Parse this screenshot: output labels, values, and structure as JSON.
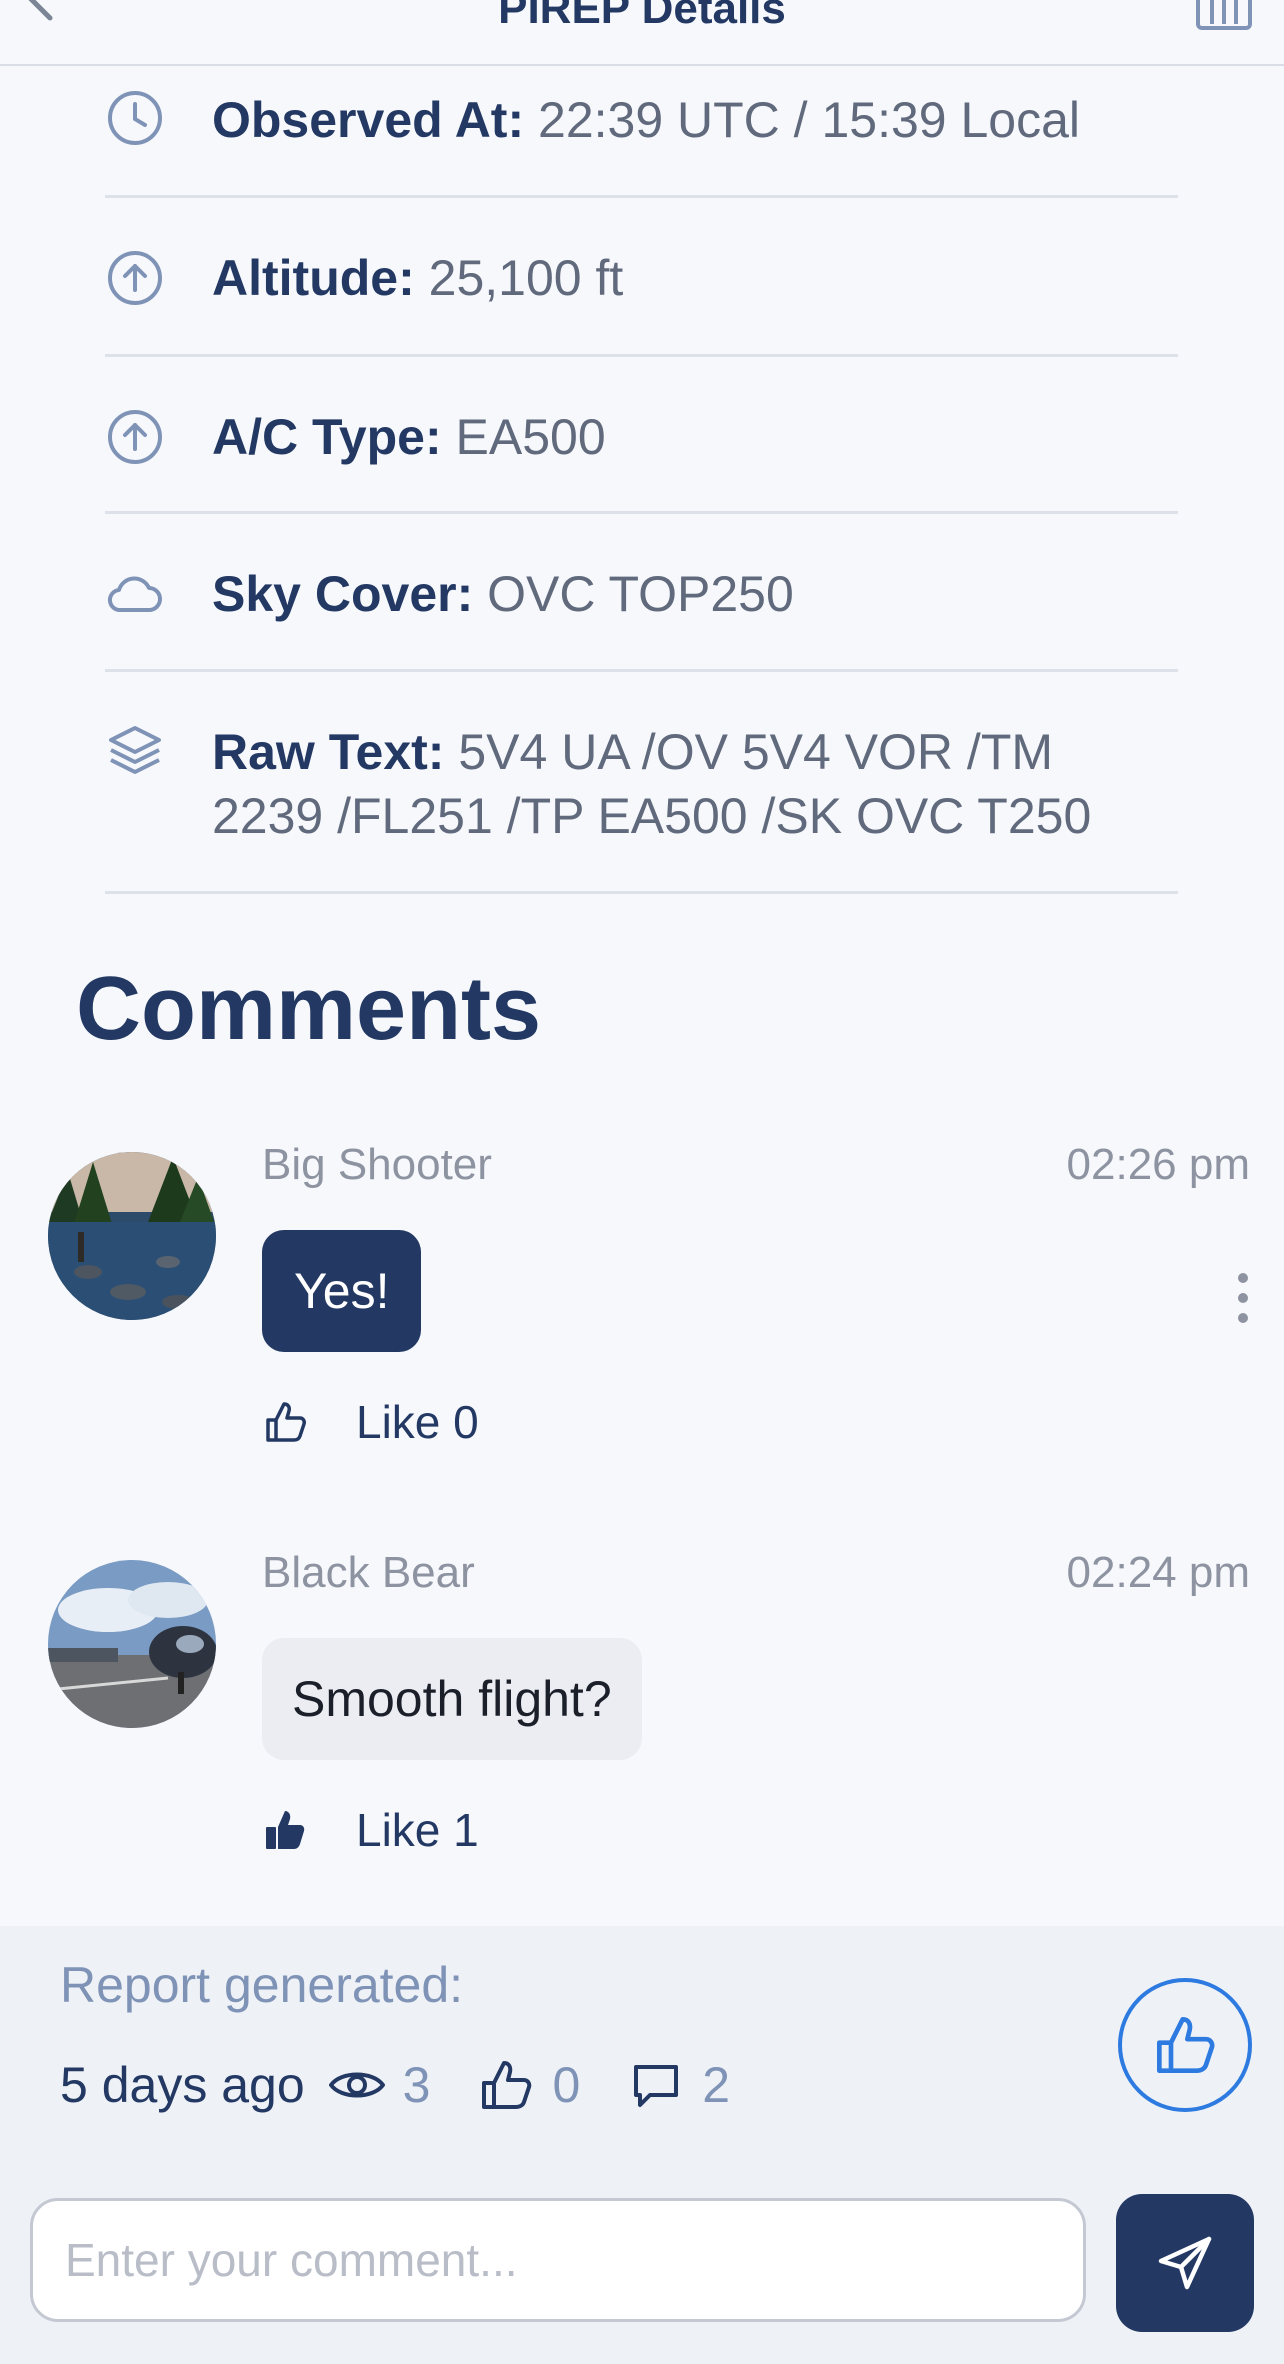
{
  "header": {
    "title": "PIREP Details"
  },
  "details": [
    {
      "icon": "clock-icon",
      "label": "Observed At:",
      "value": "22:39 UTC / 15:39 Local"
    },
    {
      "icon": "arrow-up-circle-icon",
      "label": "Altitude:",
      "value": "25,100 ft"
    },
    {
      "icon": "arrow-up-circle-icon",
      "label": "A/C Type:",
      "value": "EA500"
    },
    {
      "icon": "cloud-icon",
      "label": "Sky Cover:",
      "value": "OVC TOP250"
    },
    {
      "icon": "layers-icon",
      "label": "Raw Text:",
      "value": "5V4 UA /OV 5V4 VOR /TM 2239 /FL251 /TP EA500 /SK OVC T250"
    }
  ],
  "comments_heading": "Comments",
  "comments": [
    {
      "author": "Big Shooter",
      "time": "02:26 pm",
      "text": "Yes!",
      "like_label": "Like 0",
      "liked": false,
      "own": true
    },
    {
      "author": "Black Bear",
      "time": "02:24 pm",
      "text": "Smooth flight?",
      "like_label": "Like 1",
      "liked": true,
      "own": false
    }
  ],
  "footer": {
    "report_label": "Report generated:",
    "age": "5 days ago",
    "views": "3",
    "likes": "0",
    "comments": "2"
  },
  "input": {
    "placeholder": "Enter your comment..."
  },
  "colors": {
    "primary": "#233963",
    "accent": "#2d7be0",
    "muted": "#7f93b7"
  }
}
